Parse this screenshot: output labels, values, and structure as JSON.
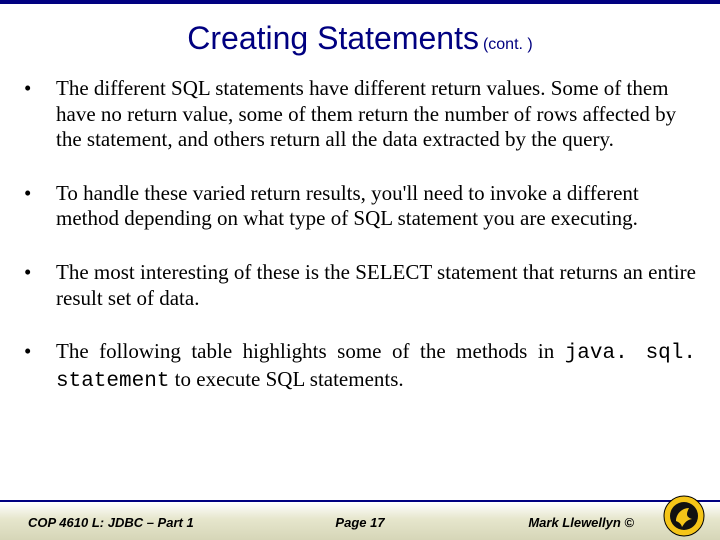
{
  "title": {
    "main": "Creating Statements",
    "sub": "(cont. )"
  },
  "bullets": [
    "The different SQL statements have different return values. Some of them have no return value, some of them return the number of rows affected by the statement, and others return all the data extracted by the query.",
    "To handle these varied return results, you'll need to invoke a different method depending on what type of SQL statement you are executing.",
    "The most interesting of these is the SELECT statement that returns an entire result set of data."
  ],
  "bullet4": {
    "pre": "The following table highlights some of the methods in ",
    "code": "java. sql. statement",
    "post": " to execute SQL statements."
  },
  "footer": {
    "left": "COP 4610 L: JDBC – Part 1",
    "mid": "Page 17",
    "right": "Mark Llewellyn ©"
  }
}
